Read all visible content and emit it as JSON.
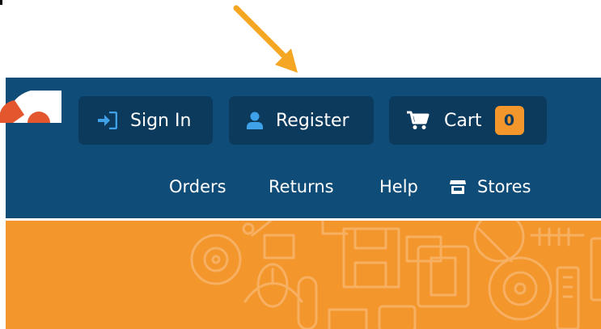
{
  "header": {
    "colors": {
      "header_bg": "#0f4c77",
      "button_bg": "#0b3a5d",
      "accent": "#f3962c",
      "icon_accent": "#3fa2e8",
      "arrow": "#f5a623"
    },
    "account_buttons": {
      "sign_in": {
        "label": "Sign In",
        "icon": "sign-in-icon"
      },
      "register": {
        "label": "Register",
        "icon": "user-icon"
      },
      "cart": {
        "label": "Cart",
        "icon": "cart-icon",
        "count": "0"
      }
    },
    "nav_links": {
      "orders": "Orders",
      "returns": "Returns",
      "help": "Help",
      "stores": {
        "label": "Stores",
        "icon": "store-icon"
      }
    }
  }
}
